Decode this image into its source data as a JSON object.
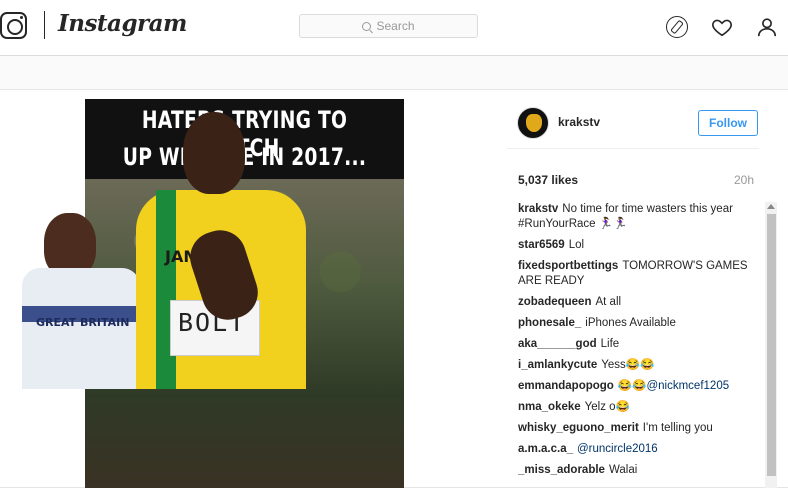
{
  "header": {
    "brand": "Instagram",
    "search_placeholder": "Search",
    "icons": [
      "instagram-camera-icon",
      "compass-icon",
      "heart-icon",
      "person-icon"
    ]
  },
  "photo": {
    "caption_line1": "HATERS TRYING TO CATCH",
    "caption_line2": "UP WITH ME IN 2017...",
    "left_jersey_text": "GREAT BRITAIN",
    "center_jersey_text": "JAMAICA",
    "bib_text": "BOLT"
  },
  "post": {
    "username": "krakstv",
    "follow_label": "Follow",
    "likes": "5,037 likes",
    "time": "20h",
    "colors": {
      "follow": "#3897f0",
      "mention": "#003569"
    }
  },
  "comments": [
    {
      "user": "krakstv",
      "text": "No time for time wasters this year #RunYourRace 🏃🏾‍♀️🏃🏾‍♀️"
    },
    {
      "user": "star6569",
      "text": "Lol"
    },
    {
      "user": "fixedsportbettings",
      "text": "TOMORROW'S GAMES ARE READY"
    },
    {
      "user": "zobadequeen",
      "text": "At all"
    },
    {
      "user": "phonesale_",
      "text": "iPhones Available"
    },
    {
      "user": "aka______god",
      "text": "Life"
    },
    {
      "user": "i_amlankycute",
      "text": "Yess😂😂"
    },
    {
      "user": "emmandapopogo",
      "text": "😂😂@nickmcef1205"
    },
    {
      "user": "nma_okeke",
      "text": "Yelz o😂"
    },
    {
      "user": "whisky_eguono_merit",
      "text": "I'm telling you"
    },
    {
      "user": "a.m.a.c.a_",
      "text": "@runcircle2016"
    },
    {
      "user": "_miss_adorable",
      "text": "Walai"
    }
  ]
}
